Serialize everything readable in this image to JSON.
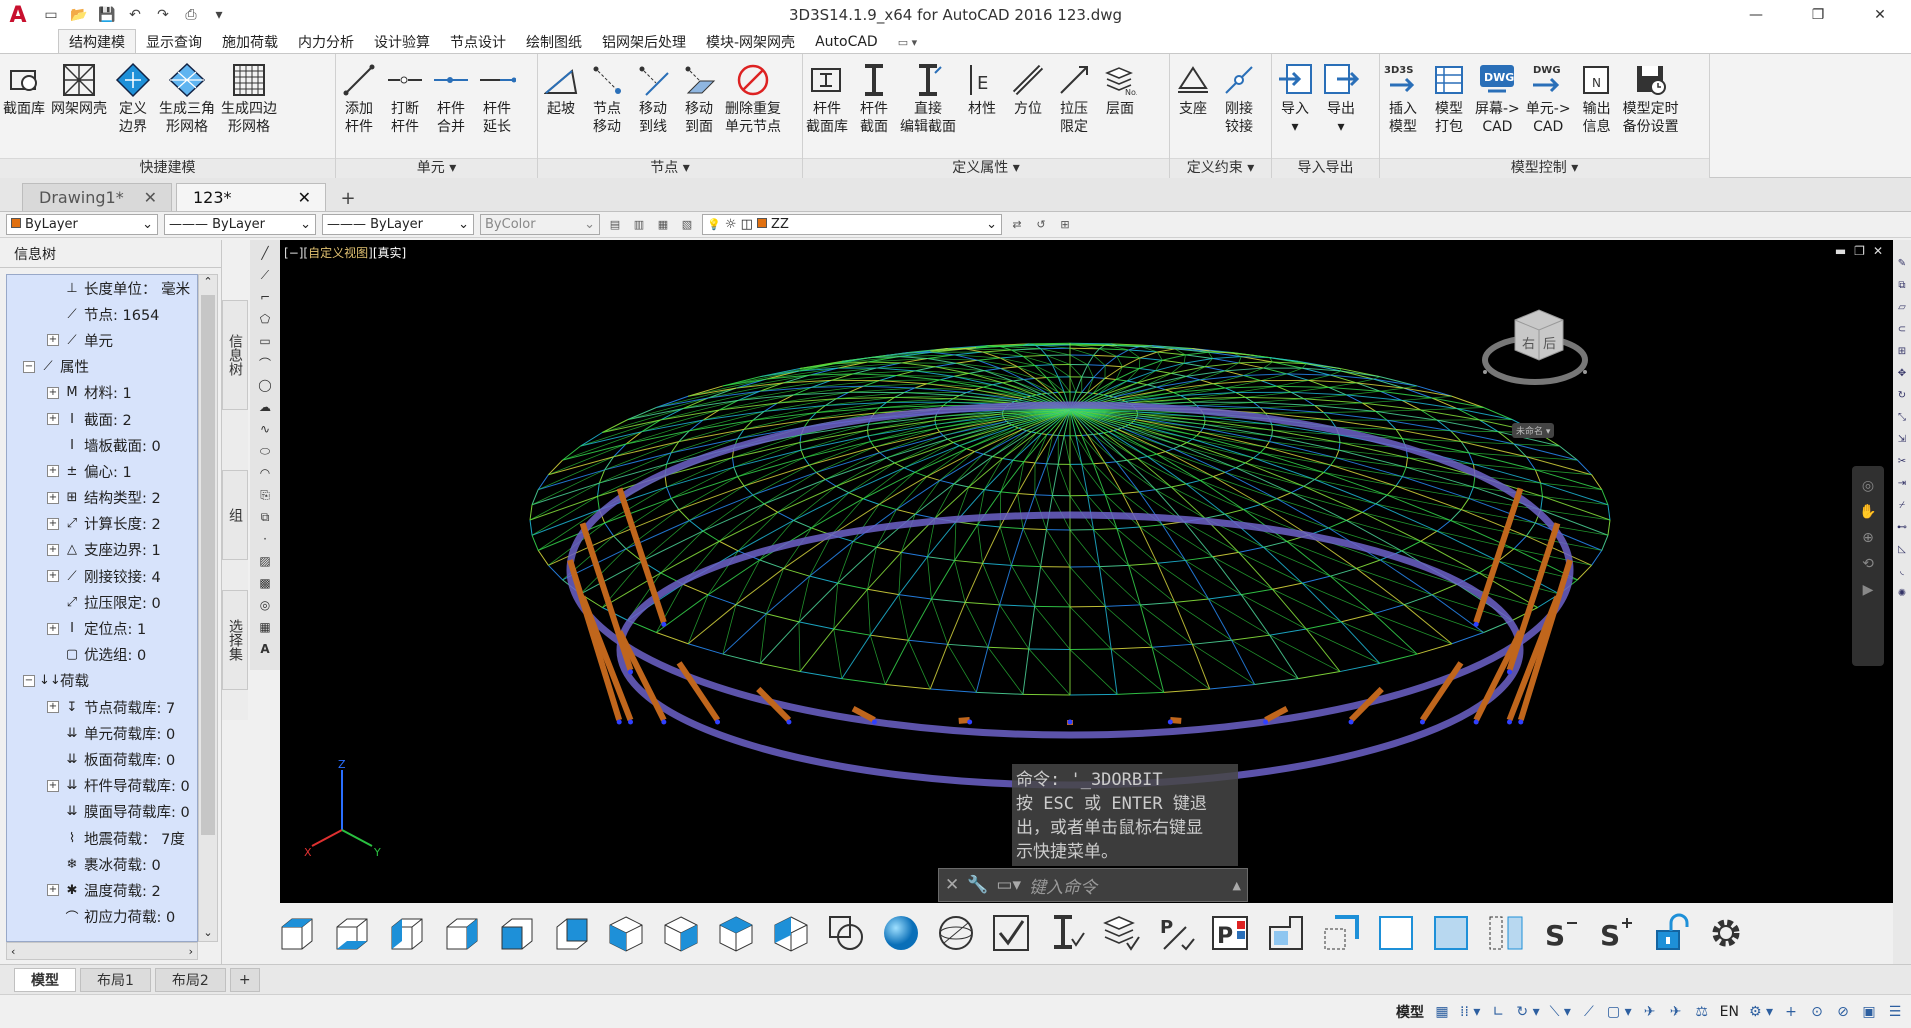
{
  "app": {
    "title": "3D3S14.1.9_x64 for AutoCAD 2016    123.dwg"
  },
  "ribbon_tabs": [
    "结构建模",
    "显示查询",
    "施加荷载",
    "内力分析",
    "设计验算",
    "节点设计",
    "绘制图纸",
    "铝网架后处理",
    "模块-网架网壳",
    "AutoCAD"
  ],
  "ribbon_panels": [
    {
      "title": "快捷建模",
      "buttons": [
        "截面库",
        "网架网壳",
        "定义\n边界",
        "生成三角\n形网格",
        "生成四边\n形网格"
      ]
    },
    {
      "title": "单元 ▾",
      "buttons": [
        "添加\n杆件",
        "打断\n杆件",
        "杆件\n合并",
        "杆件\n延长"
      ]
    },
    {
      "title": "节点 ▾",
      "buttons": [
        "起坡",
        "节点\n移动",
        "移动\n到线",
        "移动\n到面",
        "删除重复\n单元节点"
      ]
    },
    {
      "title": "定义属性 ▾",
      "buttons": [
        "杆件\n截面库",
        "杆件\n截面",
        "直接\n编辑截面",
        "材性",
        "方位",
        "拉压\n限定",
        "层面"
      ]
    },
    {
      "title": "定义约束 ▾",
      "buttons": [
        "支座",
        "刚接\n铰接"
      ]
    },
    {
      "title": "导入导出",
      "buttons": [
        "导入\n▾",
        "导出\n▾"
      ]
    },
    {
      "title": "模型控制 ▾",
      "buttons": [
        "插入\n模型",
        "模型\n打包",
        "屏幕->\nCAD",
        "单元->\nCAD",
        "输出\n信息",
        "模型定时\n备份设置"
      ]
    }
  ],
  "doc_tabs": [
    "Drawing1*",
    "123*"
  ],
  "props": {
    "color": "ByLayer",
    "linetype": "ByLayer",
    "lineweight": "ByLayer",
    "plotstyle": "ByColor",
    "layer": "ZZ"
  },
  "left_panel": {
    "title": "信息树",
    "items": [
      {
        "label": "长度单位：  毫米",
        "plus": false,
        "indent": 2,
        "icon": "ruler-icon",
        "glyph": "⊥"
      },
      {
        "label": "节点:    1654",
        "plus": false,
        "indent": 2,
        "icon": "node-icon",
        "glyph": "⟋"
      },
      {
        "label": "单元",
        "plus": true,
        "indent": 2,
        "icon": "element-icon",
        "glyph": "⟋"
      },
      {
        "label": "属性",
        "plus": true,
        "indent": 1,
        "icon": "property-icon",
        "glyph": "⟋"
      },
      {
        "label": "材料:  1",
        "plus": true,
        "indent": 2,
        "icon": "material-icon",
        "glyph": "M"
      },
      {
        "label": "截面:    2",
        "plus": true,
        "indent": 2,
        "icon": "section-icon",
        "glyph": "I"
      },
      {
        "label": "墙板截面:  0",
        "plus": false,
        "indent": 2,
        "icon": "wall-section-icon",
        "glyph": "I"
      },
      {
        "label": "偏心:  1",
        "plus": true,
        "indent": 2,
        "icon": "eccentric-icon",
        "glyph": "±"
      },
      {
        "label": "结构类型:  2",
        "plus": true,
        "indent": 2,
        "icon": "structure-type-icon",
        "glyph": "⊞"
      },
      {
        "label": "计算长度:  2",
        "plus": true,
        "indent": 2,
        "icon": "calc-length-icon",
        "glyph": "⤢"
      },
      {
        "label": "支座边界:  1",
        "plus": true,
        "indent": 2,
        "icon": "support-icon",
        "glyph": "△"
      },
      {
        "label": "刚接铰接:  4",
        "plus": true,
        "indent": 2,
        "icon": "joint-icon",
        "glyph": "⟋"
      },
      {
        "label": "拉压限定:  0",
        "plus": false,
        "indent": 2,
        "icon": "tension-icon",
        "glyph": "⤢"
      },
      {
        "label": "定位点:  1",
        "plus": true,
        "indent": 2,
        "icon": "anchor-icon",
        "glyph": "I"
      },
      {
        "label": "优选组:  0",
        "plus": false,
        "indent": 2,
        "icon": "group-icon",
        "glyph": "▢"
      },
      {
        "label": "荷载",
        "plus": true,
        "indent": 1,
        "icon": "load-icon",
        "glyph": "↓↓"
      },
      {
        "label": "节点荷载库:  7",
        "plus": true,
        "indent": 2,
        "icon": "node-load-icon",
        "glyph": "↧"
      },
      {
        "label": "单元荷载库:  0",
        "plus": false,
        "indent": 2,
        "icon": "element-load-icon",
        "glyph": "⇊"
      },
      {
        "label": "板面荷载库:  0",
        "plus": false,
        "indent": 2,
        "icon": "plate-load-icon",
        "glyph": "⇊"
      },
      {
        "label": "杆件导荷载库:  0",
        "plus": true,
        "indent": 2,
        "icon": "member-load-icon",
        "glyph": "⇊"
      },
      {
        "label": "膜面导荷载库:  0",
        "plus": false,
        "indent": 2,
        "icon": "membrane-load-icon",
        "glyph": "⇊"
      },
      {
        "label": "地震荷载：  7度",
        "plus": false,
        "indent": 2,
        "icon": "seismic-icon",
        "glyph": "⌇"
      },
      {
        "label": "裹冰荷载:  0",
        "plus": false,
        "indent": 2,
        "icon": "ice-load-icon",
        "glyph": "❄"
      },
      {
        "label": "温度荷载:  2",
        "plus": true,
        "indent": 2,
        "icon": "temp-load-icon",
        "glyph": "✱"
      },
      {
        "label": "初应力荷载:  0",
        "plus": false,
        "indent": 2,
        "icon": "prestress-icon",
        "glyph": "⌒"
      }
    ]
  },
  "side_tabs": [
    "信息树",
    "组",
    "选择集"
  ],
  "viewport": {
    "label_pre": "[",
    "label_minus": "−",
    "label_view": "自定义视图",
    "label_visual": "[真实]",
    "viewcube_top": "右",
    "viewcube_side": "后",
    "wcs": "未命名 ▾"
  },
  "command": {
    "history": "命令: '_3DORBIT\n按 ESC 或 ENTER 键退\n出，或者单击鼠标右键显\n示快捷菜单。",
    "placeholder": "键入命令"
  },
  "layout_tabs": [
    "模型",
    "布局1",
    "布局2"
  ],
  "status": {
    "model": "模型",
    "lang": "EN"
  },
  "colors": {
    "accent": "#1e90d8",
    "column": "#c0661c",
    "ring": "#6c62c8",
    "mesh": "#30d040"
  }
}
